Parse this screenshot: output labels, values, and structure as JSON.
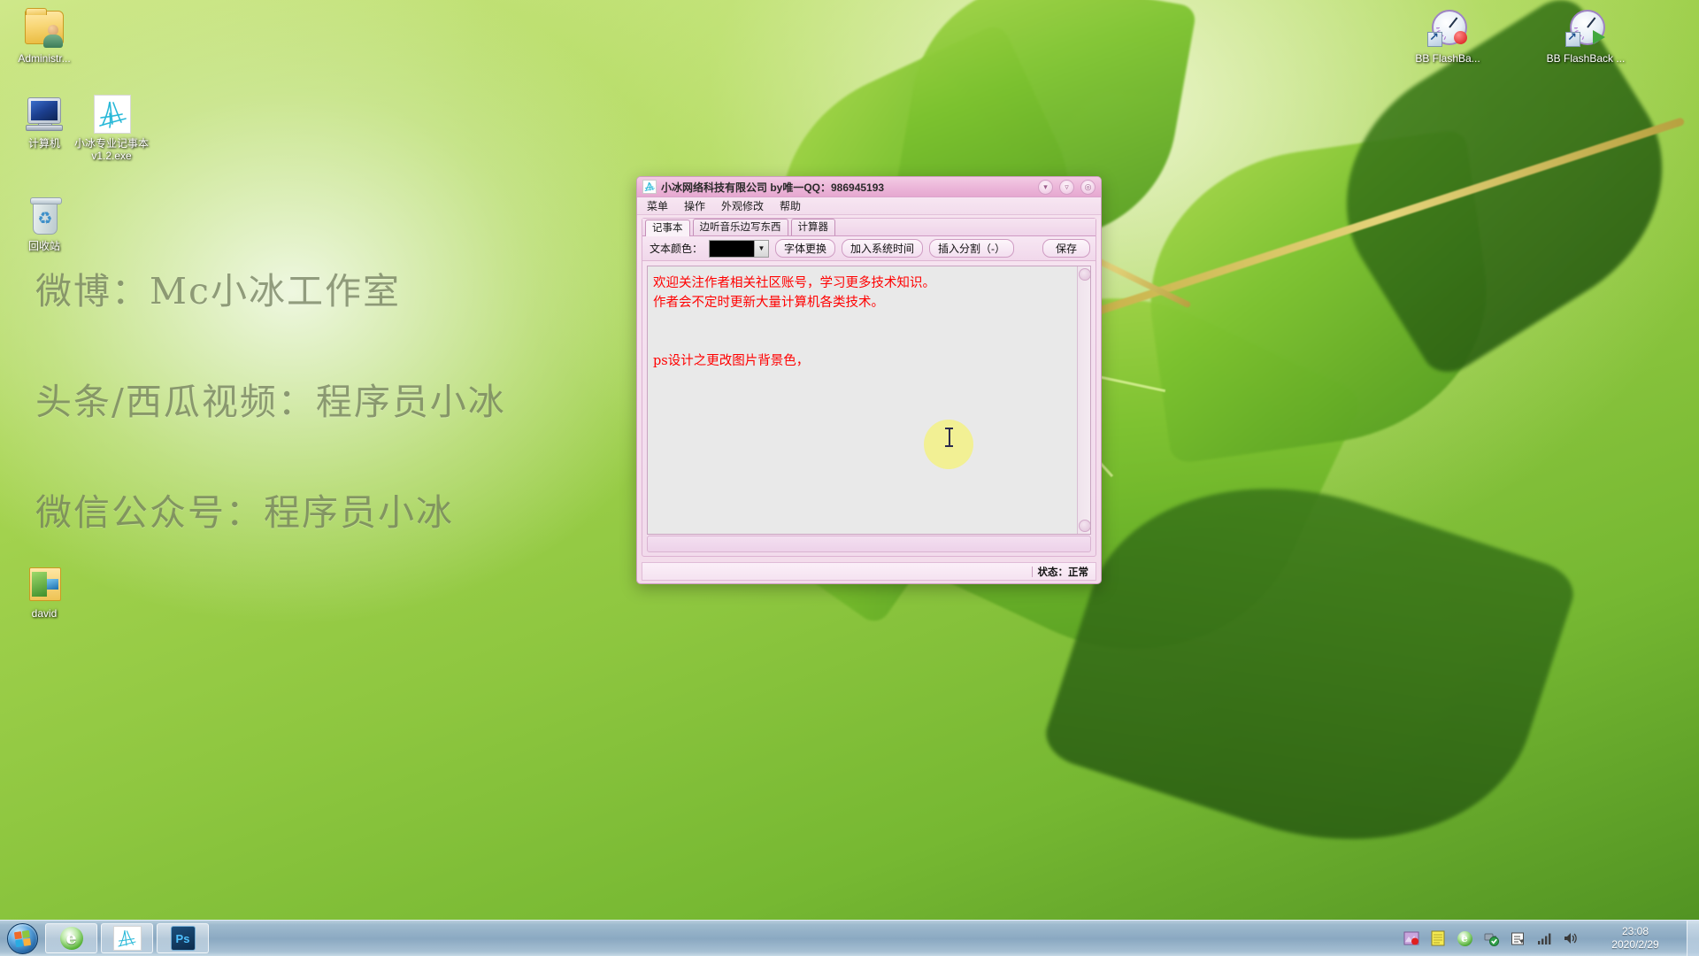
{
  "desktop": {
    "watermarks": [
      "微博：Mc小冰工作室",
      "头条/西瓜视频：程序员小冰",
      "微信公众号：程序员小冰"
    ],
    "icons": [
      {
        "name": "administrator-folder",
        "label": "Administr...",
        "icon": "user-folder-icon"
      },
      {
        "name": "computer",
        "label": "计算机",
        "icon": "computer-icon"
      },
      {
        "name": "notepad-app",
        "label": "小冰专业记事本 v1.2.exe",
        "icon": "scribble-app-icon"
      },
      {
        "name": "recycle-bin",
        "label": "回收站",
        "icon": "recycle-bin-icon"
      },
      {
        "name": "david-folder",
        "label": "david",
        "icon": "folder-icon"
      },
      {
        "name": "bb-flashback-recorder",
        "label": "BB FlashBa...",
        "icon": "gauge-record-icon"
      },
      {
        "name": "bb-flashback-player",
        "label": "BB FlashBack ...",
        "icon": "gauge-play-icon"
      }
    ]
  },
  "window": {
    "title": "小冰网络科技有限公司 by唯一QQ：986945193",
    "title_icon": "scribble-app-icon",
    "controls": {
      "minimize": "▾",
      "maximize": "▿",
      "close": "◎"
    },
    "menus": [
      "菜单",
      "操作",
      "外观修改",
      "帮助"
    ],
    "tabs": [
      {
        "label": "记事本",
        "active": true
      },
      {
        "label": "边听音乐边写东西",
        "active": false
      },
      {
        "label": "计算器",
        "active": false
      }
    ],
    "toolbar": {
      "color_label": "文本颜色：",
      "color_value": "#000000",
      "dropdown_arrow": "▼",
      "font_button": "字体更换",
      "time_button": "加入系统时间",
      "divider_button": "插入分割（-）",
      "save_button": "保存"
    },
    "editor": {
      "text_color": "#ff0000",
      "lines": [
        "欢迎关注作者相关社区账号，学习更多技术知识。",
        "作者会不定时更新大量计算机各类技术。",
        "",
        "",
        "ps设计之更改图片背景色，",
        ""
      ]
    },
    "statusbar": {
      "text": "状态：正常"
    }
  },
  "taskbar": {
    "start": "start-orb",
    "tasks": [
      {
        "name": "internet-explorer",
        "glyph": "e"
      },
      {
        "name": "notepad-app",
        "glyph": "scribble"
      },
      {
        "name": "photoshop",
        "glyph": "Ps"
      }
    ],
    "tray": [
      "recorder-icon",
      "notes-icon",
      "ie-icon",
      "usb-safe-icon",
      "input-method-icon",
      "network-icon",
      "volume-icon"
    ],
    "clock": {
      "time": "23:08",
      "date": "2020/2/29"
    }
  }
}
